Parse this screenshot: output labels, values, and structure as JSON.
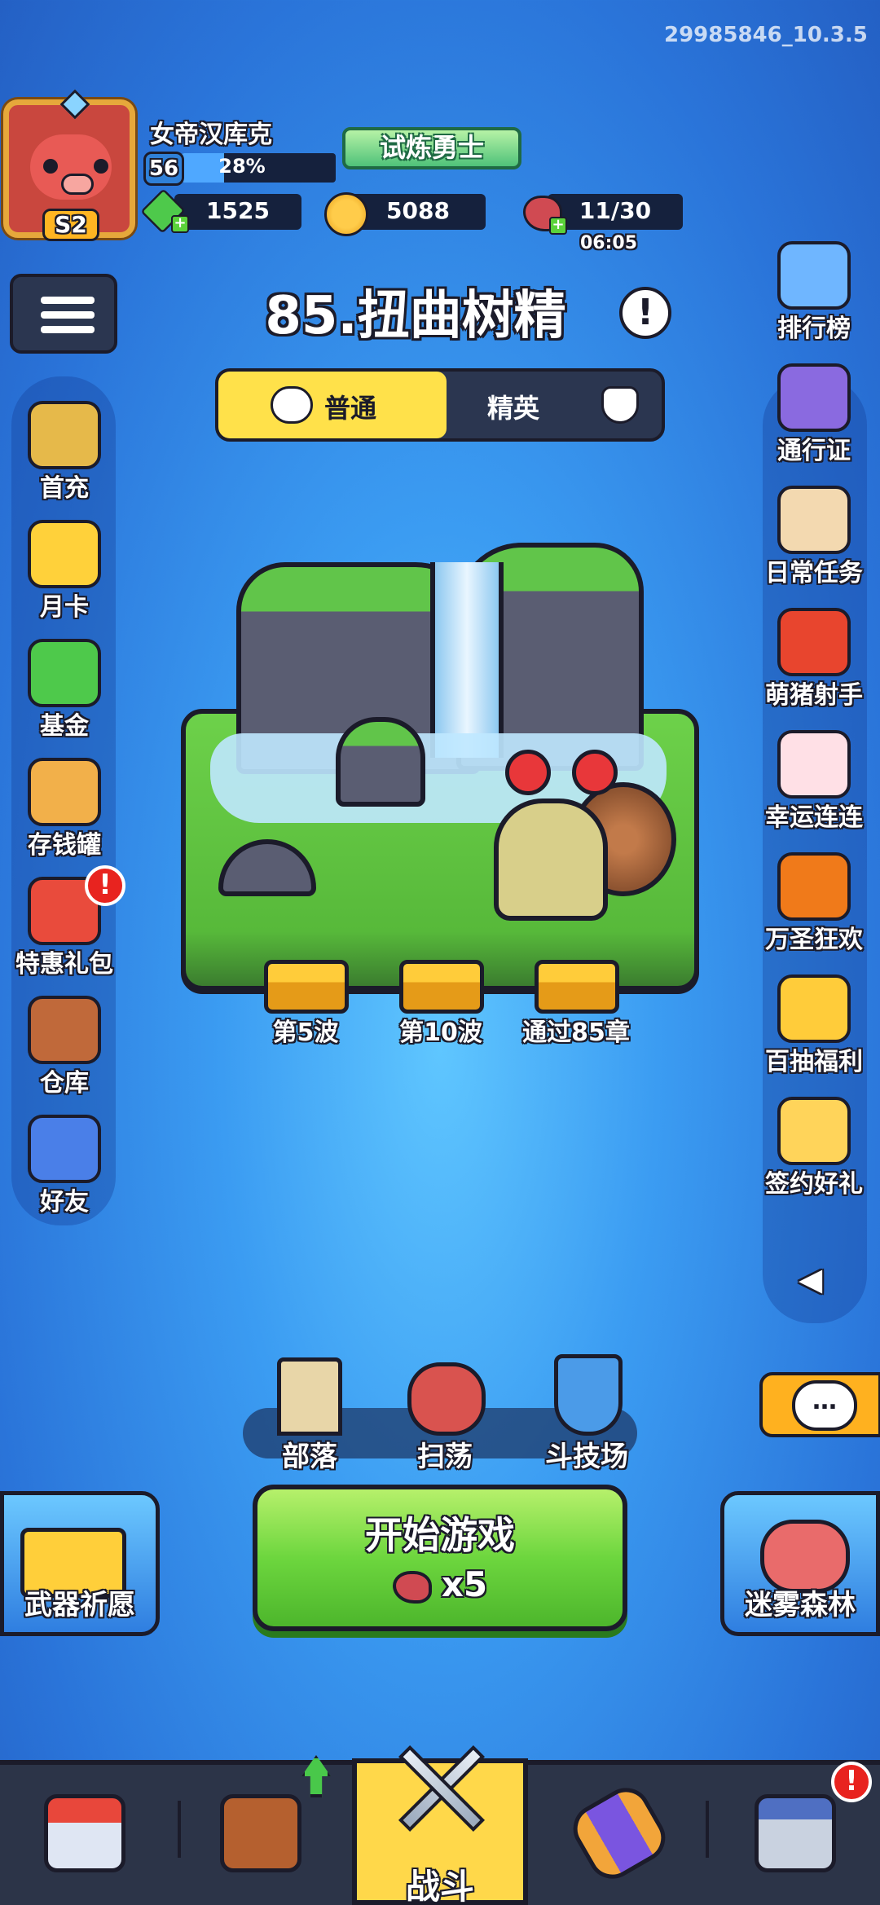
{
  "version": "29985846_10.3.5",
  "player": {
    "name": "女帝汉库克",
    "level": "56",
    "xp_percent_label": "28%",
    "xp_fraction": 0.28,
    "season_badge": "S2",
    "title": "试炼勇士"
  },
  "currency": {
    "gems": "1525",
    "coins": "5088",
    "energy": "11/30",
    "energy_timer": "06:05"
  },
  "chapter": {
    "title": "85.扭曲树精",
    "info_icon": "!"
  },
  "difficulty": {
    "normal": "普通",
    "elite": "精英",
    "selected": "normal"
  },
  "left_menu": [
    {
      "label": "首充",
      "icon": "first-recharge-icon",
      "color": "#e6b94a"
    },
    {
      "label": "月卡",
      "icon": "monthly-card-icon",
      "color": "#ffd13a"
    },
    {
      "label": "基金",
      "icon": "fund-icon",
      "color": "#4ec94b"
    },
    {
      "label": "存钱罐",
      "icon": "piggy-bank-icon",
      "color": "#f2b04a"
    },
    {
      "label": "特惠礼包",
      "icon": "gift-pack-icon",
      "color": "#e94b3c",
      "badge": "!"
    },
    {
      "label": "仓库",
      "icon": "warehouse-icon",
      "color": "#c0693a"
    },
    {
      "label": "好友",
      "icon": "friends-icon",
      "color": "#4a7fe8"
    }
  ],
  "right_menu": [
    {
      "label": "排行榜",
      "icon": "leaderboard-icon",
      "color": "#6fb6ff"
    },
    {
      "label": "通行证",
      "icon": "pass-icon",
      "color": "#8a6ae0"
    },
    {
      "label": "日常任务",
      "icon": "daily-tasks-icon",
      "color": "#f3d9b0"
    },
    {
      "label": "萌猪射手",
      "icon": "pig-shooter-icon",
      "color": "#e8452e"
    },
    {
      "label": "幸运连连",
      "icon": "lucky-cake-icon",
      "color": "#ffe0e6"
    },
    {
      "label": "万圣狂欢",
      "icon": "halloween-icon",
      "color": "#f07a1a"
    },
    {
      "label": "百抽福利",
      "icon": "hundred-draw-icon",
      "color": "#ffcc3a"
    },
    {
      "label": "签约好礼",
      "icon": "contract-gift-icon",
      "color": "#ffd45a"
    }
  ],
  "collapse_arrow": "◀",
  "rewards": [
    {
      "label": "第5波"
    },
    {
      "label": "第10波"
    },
    {
      "label": "通过85章"
    }
  ],
  "mid_buttons": [
    {
      "label": "部落",
      "icon": "tribe-castle-icon"
    },
    {
      "label": "扫荡",
      "icon": "sweep-icon"
    },
    {
      "label": "斗技场",
      "icon": "arena-icon"
    }
  ],
  "chat_icon": "…",
  "weapon_wish": "武器祈愿",
  "misty_forest": "迷雾森林",
  "start_game": {
    "label": "开始游戏",
    "cost": "x5"
  },
  "bottom_nav": {
    "shop": "shop-icon",
    "backpack": "backpack-icon",
    "battle_label": "战斗",
    "scroll": "scroll-icon",
    "building": "building-icon",
    "building_badge": "!"
  }
}
